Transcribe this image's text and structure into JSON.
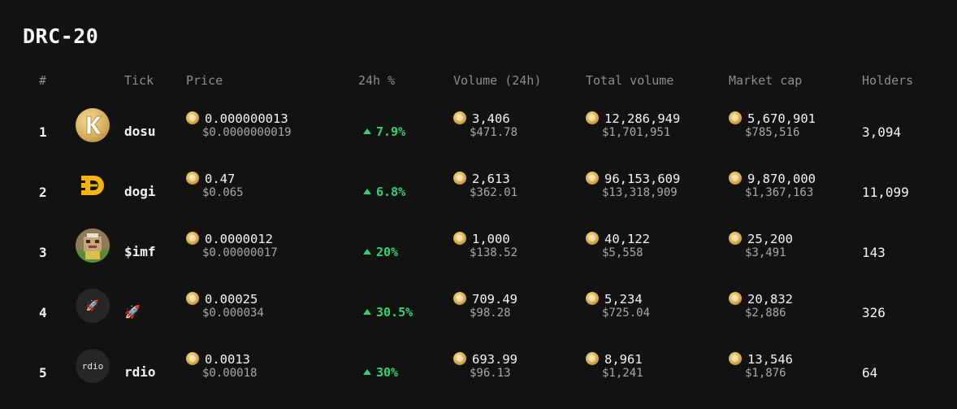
{
  "title": "DRC-20",
  "headers": {
    "rank": "#",
    "tick": "Tick",
    "price": "Price",
    "change": "24h %",
    "volume": "Volume (24h)",
    "total_volume": "Total volume",
    "market_cap": "Market cap",
    "holders": "Holders"
  },
  "rows": [
    {
      "rank": "1",
      "tick": "dosu",
      "logo": "dosu-k-logo-icon",
      "price": "0.000000013",
      "price_usd": "$0.0000000019",
      "change": "7.9%",
      "volume": "3,406",
      "volume_usd": "$471.78",
      "total_volume": "12,286,949",
      "total_volume_usd": "$1,701,951",
      "market_cap": "5,670,901",
      "market_cap_usd": "$785,516",
      "holders": "3,094"
    },
    {
      "rank": "2",
      "tick": "dogi",
      "logo": "dogi-d-logo-icon",
      "price": "0.47",
      "price_usd": "$0.065",
      "change": "6.8%",
      "volume": "2,613",
      "volume_usd": "$362.01",
      "total_volume": "96,153,609",
      "total_volume_usd": "$13,318,909",
      "market_cap": "9,870,000",
      "market_cap_usd": "$1,367,163",
      "holders": "11,099"
    },
    {
      "rank": "3",
      "tick": "$imf",
      "logo": "imf-pixel-avatar-icon",
      "price": "0.0000012",
      "price_usd": "$0.00000017",
      "change": "20%",
      "volume": "1,000",
      "volume_usd": "$138.52",
      "total_volume": "40,122",
      "total_volume_usd": "$5,558",
      "market_cap": "25,200",
      "market_cap_usd": "$3,491",
      "holders": "143"
    },
    {
      "rank": "4",
      "tick": "🚀",
      "logo_text": "🚀",
      "logo": "rocket-icon",
      "price": "0.00025",
      "price_usd": "$0.000034",
      "change": "30.5%",
      "volume": "709.49",
      "volume_usd": "$98.28",
      "total_volume": "5,234",
      "total_volume_usd": "$725.04",
      "market_cap": "20,832",
      "market_cap_usd": "$2,886",
      "holders": "326"
    },
    {
      "rank": "5",
      "tick": "rdio",
      "logo_text": "rdio",
      "logo": "rdio-text-logo-icon",
      "price": "0.0013",
      "price_usd": "$0.00018",
      "change": "30%",
      "volume": "693.99",
      "volume_usd": "$96.13",
      "total_volume": "8,961",
      "total_volume_usd": "$1,241",
      "market_cap": "13,546",
      "market_cap_usd": "$1,876",
      "holders": "64"
    }
  ],
  "colors": {
    "background": "#121212",
    "positive": "#31d36f",
    "muted": "#8d8d8d",
    "gold": "#f5b400"
  }
}
